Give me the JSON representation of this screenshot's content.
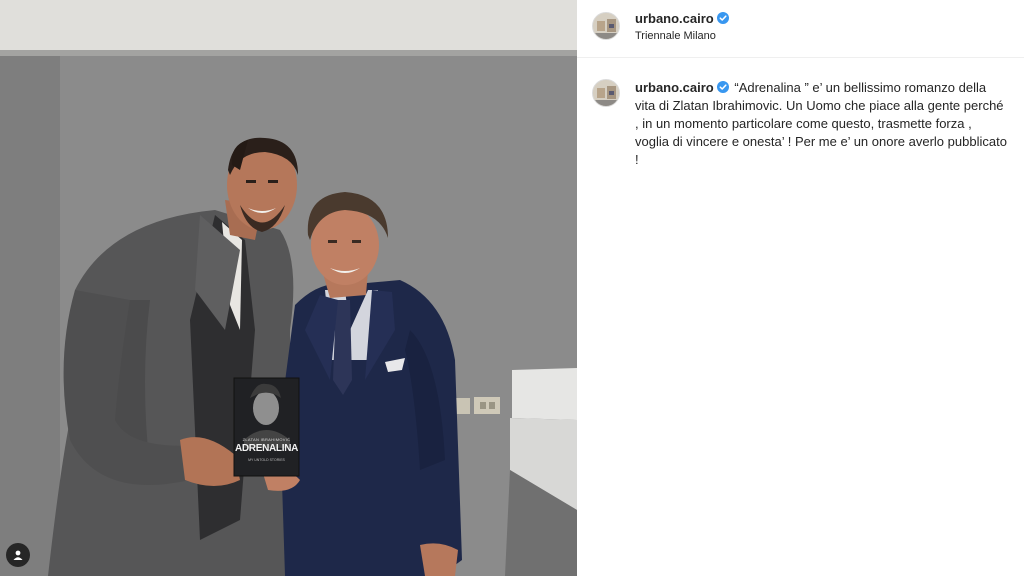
{
  "post": {
    "username": "urbano.cairo",
    "verified": true,
    "location": "Triennale Milano",
    "caption": "“Adrenalina ” e’ un bellissimo romanzo della vita di Zlatan Ibrahimovic. Un Uomo che piace alla gente perché , in un momento particolare come questo, trasmette forza , voglia di vincere e onesta’ ! Per me e’ un onore averlo pubblicato !"
  },
  "book": {
    "author": "ZLATAN IBRAHIMOVIĆ",
    "title": "ADRENALINA",
    "subtitle": "MY UNTOLD STORIES"
  },
  "colors": {
    "verified_badge": "#3897f0",
    "wall_gray": "#8c8c8c",
    "wall_top": "#dcdcd8",
    "suit_navy": "#1d2748",
    "coat_gray": "#555556"
  },
  "icons": {
    "verified": "verified-badge-icon",
    "tag": "user-tag-icon"
  }
}
